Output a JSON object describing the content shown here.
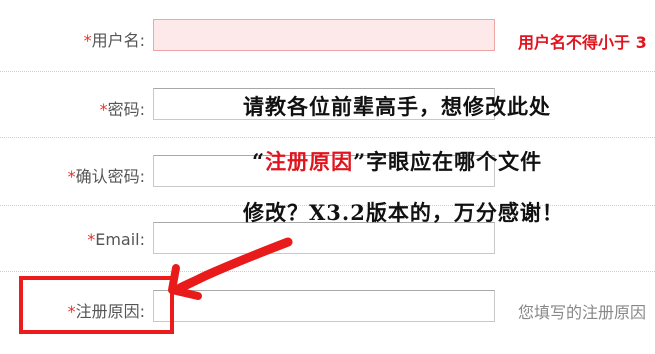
{
  "form": {
    "required_mark": "*",
    "fields": [
      {
        "label": "用户名:",
        "error": "用户名不得小于 3"
      },
      {
        "label": "密码:"
      },
      {
        "label": "确认密码:"
      },
      {
        "label": "Email:"
      },
      {
        "label": "注册原因:",
        "hint": "您填写的注册原因"
      }
    ]
  },
  "annotation": {
    "line1": "请教各位前辈高手，想修改此处",
    "line2_open": "“",
    "line2_highlight": "注册原因",
    "line2_rest": "”字眼应在哪个文件",
    "line3": "修改？X3.2版本的，万分感谢！"
  },
  "colors": {
    "required": "#e83030",
    "error_text": "#e0141e",
    "highlight_box": "#ec1c1c"
  }
}
